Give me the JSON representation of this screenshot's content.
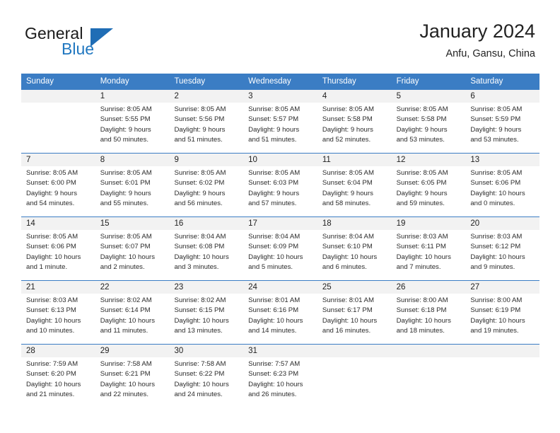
{
  "brand": {
    "name_part1": "General",
    "name_part2": "Blue",
    "triangle_color": "#1f6db5",
    "blue_text_color": "#2077c0"
  },
  "header": {
    "month_title": "January 2024",
    "location": "Anfu, Gansu, China"
  },
  "theme": {
    "header_bar_color": "#3b7dc4",
    "daynum_band_color": "#f2f2f2",
    "grid_line_color": "#3b7dc4"
  },
  "weekdays": [
    "Sunday",
    "Monday",
    "Tuesday",
    "Wednesday",
    "Thursday",
    "Friday",
    "Saturday"
  ],
  "weeks": [
    [
      {
        "day": "",
        "sunrise": "",
        "sunset": "",
        "daylight_line1": "",
        "daylight_line2": "",
        "empty": true
      },
      {
        "day": "1",
        "sunrise": "Sunrise: 8:05 AM",
        "sunset": "Sunset: 5:55 PM",
        "daylight_line1": "Daylight: 9 hours",
        "daylight_line2": "and 50 minutes."
      },
      {
        "day": "2",
        "sunrise": "Sunrise: 8:05 AM",
        "sunset": "Sunset: 5:56 PM",
        "daylight_line1": "Daylight: 9 hours",
        "daylight_line2": "and 51 minutes."
      },
      {
        "day": "3",
        "sunrise": "Sunrise: 8:05 AM",
        "sunset": "Sunset: 5:57 PM",
        "daylight_line1": "Daylight: 9 hours",
        "daylight_line2": "and 51 minutes."
      },
      {
        "day": "4",
        "sunrise": "Sunrise: 8:05 AM",
        "sunset": "Sunset: 5:58 PM",
        "daylight_line1": "Daylight: 9 hours",
        "daylight_line2": "and 52 minutes."
      },
      {
        "day": "5",
        "sunrise": "Sunrise: 8:05 AM",
        "sunset": "Sunset: 5:58 PM",
        "daylight_line1": "Daylight: 9 hours",
        "daylight_line2": "and 53 minutes."
      },
      {
        "day": "6",
        "sunrise": "Sunrise: 8:05 AM",
        "sunset": "Sunset: 5:59 PM",
        "daylight_line1": "Daylight: 9 hours",
        "daylight_line2": "and 53 minutes."
      }
    ],
    [
      {
        "day": "7",
        "sunrise": "Sunrise: 8:05 AM",
        "sunset": "Sunset: 6:00 PM",
        "daylight_line1": "Daylight: 9 hours",
        "daylight_line2": "and 54 minutes."
      },
      {
        "day": "8",
        "sunrise": "Sunrise: 8:05 AM",
        "sunset": "Sunset: 6:01 PM",
        "daylight_line1": "Daylight: 9 hours",
        "daylight_line2": "and 55 minutes."
      },
      {
        "day": "9",
        "sunrise": "Sunrise: 8:05 AM",
        "sunset": "Sunset: 6:02 PM",
        "daylight_line1": "Daylight: 9 hours",
        "daylight_line2": "and 56 minutes."
      },
      {
        "day": "10",
        "sunrise": "Sunrise: 8:05 AM",
        "sunset": "Sunset: 6:03 PM",
        "daylight_line1": "Daylight: 9 hours",
        "daylight_line2": "and 57 minutes."
      },
      {
        "day": "11",
        "sunrise": "Sunrise: 8:05 AM",
        "sunset": "Sunset: 6:04 PM",
        "daylight_line1": "Daylight: 9 hours",
        "daylight_line2": "and 58 minutes."
      },
      {
        "day": "12",
        "sunrise": "Sunrise: 8:05 AM",
        "sunset": "Sunset: 6:05 PM",
        "daylight_line1": "Daylight: 9 hours",
        "daylight_line2": "and 59 minutes."
      },
      {
        "day": "13",
        "sunrise": "Sunrise: 8:05 AM",
        "sunset": "Sunset: 6:06 PM",
        "daylight_line1": "Daylight: 10 hours",
        "daylight_line2": "and 0 minutes."
      }
    ],
    [
      {
        "day": "14",
        "sunrise": "Sunrise: 8:05 AM",
        "sunset": "Sunset: 6:06 PM",
        "daylight_line1": "Daylight: 10 hours",
        "daylight_line2": "and 1 minute."
      },
      {
        "day": "15",
        "sunrise": "Sunrise: 8:05 AM",
        "sunset": "Sunset: 6:07 PM",
        "daylight_line1": "Daylight: 10 hours",
        "daylight_line2": "and 2 minutes."
      },
      {
        "day": "16",
        "sunrise": "Sunrise: 8:04 AM",
        "sunset": "Sunset: 6:08 PM",
        "daylight_line1": "Daylight: 10 hours",
        "daylight_line2": "and 3 minutes."
      },
      {
        "day": "17",
        "sunrise": "Sunrise: 8:04 AM",
        "sunset": "Sunset: 6:09 PM",
        "daylight_line1": "Daylight: 10 hours",
        "daylight_line2": "and 5 minutes."
      },
      {
        "day": "18",
        "sunrise": "Sunrise: 8:04 AM",
        "sunset": "Sunset: 6:10 PM",
        "daylight_line1": "Daylight: 10 hours",
        "daylight_line2": "and 6 minutes."
      },
      {
        "day": "19",
        "sunrise": "Sunrise: 8:03 AM",
        "sunset": "Sunset: 6:11 PM",
        "daylight_line1": "Daylight: 10 hours",
        "daylight_line2": "and 7 minutes."
      },
      {
        "day": "20",
        "sunrise": "Sunrise: 8:03 AM",
        "sunset": "Sunset: 6:12 PM",
        "daylight_line1": "Daylight: 10 hours",
        "daylight_line2": "and 9 minutes."
      }
    ],
    [
      {
        "day": "21",
        "sunrise": "Sunrise: 8:03 AM",
        "sunset": "Sunset: 6:13 PM",
        "daylight_line1": "Daylight: 10 hours",
        "daylight_line2": "and 10 minutes."
      },
      {
        "day": "22",
        "sunrise": "Sunrise: 8:02 AM",
        "sunset": "Sunset: 6:14 PM",
        "daylight_line1": "Daylight: 10 hours",
        "daylight_line2": "and 11 minutes."
      },
      {
        "day": "23",
        "sunrise": "Sunrise: 8:02 AM",
        "sunset": "Sunset: 6:15 PM",
        "daylight_line1": "Daylight: 10 hours",
        "daylight_line2": "and 13 minutes."
      },
      {
        "day": "24",
        "sunrise": "Sunrise: 8:01 AM",
        "sunset": "Sunset: 6:16 PM",
        "daylight_line1": "Daylight: 10 hours",
        "daylight_line2": "and 14 minutes."
      },
      {
        "day": "25",
        "sunrise": "Sunrise: 8:01 AM",
        "sunset": "Sunset: 6:17 PM",
        "daylight_line1": "Daylight: 10 hours",
        "daylight_line2": "and 16 minutes."
      },
      {
        "day": "26",
        "sunrise": "Sunrise: 8:00 AM",
        "sunset": "Sunset: 6:18 PM",
        "daylight_line1": "Daylight: 10 hours",
        "daylight_line2": "and 18 minutes."
      },
      {
        "day": "27",
        "sunrise": "Sunrise: 8:00 AM",
        "sunset": "Sunset: 6:19 PM",
        "daylight_line1": "Daylight: 10 hours",
        "daylight_line2": "and 19 minutes."
      }
    ],
    [
      {
        "day": "28",
        "sunrise": "Sunrise: 7:59 AM",
        "sunset": "Sunset: 6:20 PM",
        "daylight_line1": "Daylight: 10 hours",
        "daylight_line2": "and 21 minutes."
      },
      {
        "day": "29",
        "sunrise": "Sunrise: 7:58 AM",
        "sunset": "Sunset: 6:21 PM",
        "daylight_line1": "Daylight: 10 hours",
        "daylight_line2": "and 22 minutes."
      },
      {
        "day": "30",
        "sunrise": "Sunrise: 7:58 AM",
        "sunset": "Sunset: 6:22 PM",
        "daylight_line1": "Daylight: 10 hours",
        "daylight_line2": "and 24 minutes."
      },
      {
        "day": "31",
        "sunrise": "Sunrise: 7:57 AM",
        "sunset": "Sunset: 6:23 PM",
        "daylight_line1": "Daylight: 10 hours",
        "daylight_line2": "and 26 minutes."
      },
      {
        "day": "",
        "sunrise": "",
        "sunset": "",
        "daylight_line1": "",
        "daylight_line2": "",
        "empty": true
      },
      {
        "day": "",
        "sunrise": "",
        "sunset": "",
        "daylight_line1": "",
        "daylight_line2": "",
        "empty": true
      },
      {
        "day": "",
        "sunrise": "",
        "sunset": "",
        "daylight_line1": "",
        "daylight_line2": "",
        "empty": true
      }
    ]
  ]
}
